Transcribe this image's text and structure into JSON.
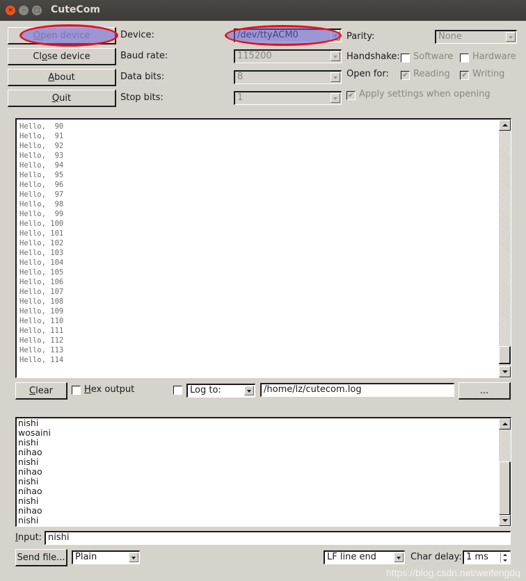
{
  "window": {
    "title": "CuteCom",
    "controls": {
      "close": "×",
      "minimize": "–",
      "maximize": "□"
    }
  },
  "buttons": {
    "open_device": {
      "pre": "",
      "mnemonic": "O",
      "post": "pen device"
    },
    "close_device": {
      "pre": "Cl",
      "mnemonic": "o",
      "post": "se device"
    },
    "about": {
      "pre": "",
      "mnemonic": "A",
      "post": "bout"
    },
    "quit": {
      "pre": "",
      "mnemonic": "Q",
      "post": "uit"
    }
  },
  "settings": {
    "device_label": "Device:",
    "device_value": "/dev/ttyACM0",
    "baud_label": "Baud rate:",
    "baud_value": "115200",
    "data_bits_label": "Data bits:",
    "data_bits_value": "8",
    "stop_bits_label": "Stop bits:",
    "stop_bits_value": "1",
    "parity_label": "Parity:",
    "parity_value": "None",
    "handshake_label": "Handshake:",
    "software_label": "Software",
    "software_checked": false,
    "hardware_label": "Hardware",
    "hardware_checked": false,
    "open_for_label": "Open for:",
    "reading_label": "Reading",
    "reading_checked": true,
    "writing_label": "Writing",
    "writing_checked": true,
    "apply_label": "Apply settings when opening",
    "apply_checked": true
  },
  "output": {
    "lines": [
      "Hello,  90",
      "Hello,  91",
      "Hello,  92",
      "Hello,  93",
      "Hello,  94",
      "Hello,  95",
      "Hello,  96",
      "Hello,  97",
      "Hello,  98",
      "Hello,  99",
      "Hello, 100",
      "Hello, 101",
      "Hello, 102",
      "Hello, 103",
      "Hello, 104",
      "Hello, 105",
      "Hello, 106",
      "Hello, 107",
      "Hello, 108",
      "Hello, 109",
      "Hello, 110",
      "Hello, 111",
      "Hello, 112",
      "Hello, 113",
      "Hello, 114"
    ]
  },
  "output_controls": {
    "clear": {
      "pre": "",
      "mnemonic": "C",
      "post": "lear"
    },
    "hex_output": {
      "pre": "",
      "mnemonic": "H",
      "post": "ex output"
    },
    "hex_checked": false,
    "log_checked": false,
    "log_to": "Log to:",
    "log_path": "/home/lz/cutecom.log",
    "browse": "..."
  },
  "history": {
    "lines": [
      "nishi",
      "wosaini",
      "nishi",
      "nihao",
      "nishi",
      "nihao",
      "nishi",
      "nihao",
      "nishi",
      "nihao",
      "nishi"
    ]
  },
  "input": {
    "label_mnemonic": "I",
    "label_rest": "nput:",
    "value": "nishi"
  },
  "bottom": {
    "send_file": "Send file...",
    "format": "Plain",
    "line_end": "LF line end",
    "char_delay_label": "Char delay:",
    "char_delay_value": "1 ms"
  },
  "watermark": "https://blog.csdn.net/weifengdq"
}
